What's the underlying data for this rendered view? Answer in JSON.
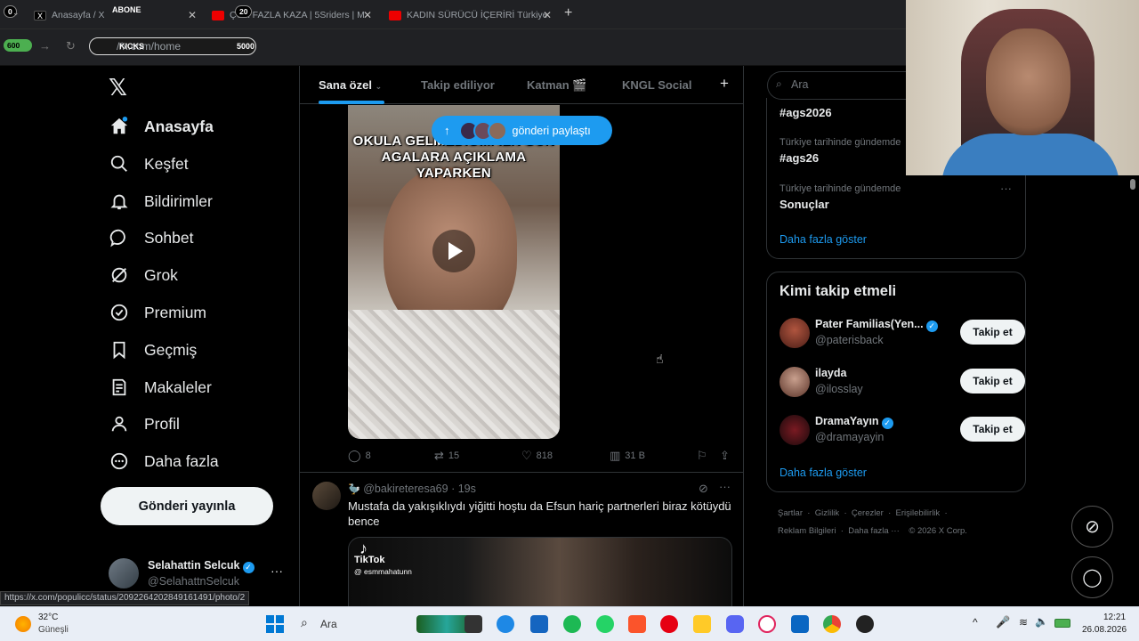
{
  "browser": {
    "tabs": [
      {
        "title": "Anasayfa / X"
      },
      {
        "title": "ÇOK FAZLA KAZA | 5Sriders | M"
      },
      {
        "title": "KADIN SÜRÜCÜ İÇERİRİ Türkiye"
      }
    ],
    "overlay_pills": {
      "p1": "0",
      "p2": "ABONE",
      "p3": "20",
      "p4": "600",
      "p5": "KICKS",
      "p6": "5000"
    },
    "url": "//x.com/home",
    "status_url": "https://x.com/populicc/status/2092264202849161491/photo/2"
  },
  "nav": {
    "items": [
      {
        "label": "Anasayfa",
        "icon": "home-icon"
      },
      {
        "label": "Keşfet",
        "icon": "search-icon"
      },
      {
        "label": "Bildirimler",
        "icon": "bell-icon"
      },
      {
        "label": "Sohbet",
        "icon": "chat-icon"
      },
      {
        "label": "Grok",
        "icon": "grok-icon"
      },
      {
        "label": "Premium",
        "icon": "premium-icon"
      },
      {
        "label": "Geçmiş",
        "icon": "bookmark-icon"
      },
      {
        "label": "Makaleler",
        "icon": "article-icon"
      },
      {
        "label": "Profil",
        "icon": "person-icon"
      },
      {
        "label": "Daha fazla",
        "icon": "more-circle-icon"
      }
    ],
    "post_button": "Gönderi yayınla",
    "account": {
      "name": "Selahattin Selcuk",
      "handle": "@SelahattnSelcuk"
    }
  },
  "feed": {
    "tabs": [
      "Sana özel",
      "Takip ediliyor",
      "Katman 🎬",
      "KNGL Social"
    ],
    "toast": "gönderi paylaştı",
    "tweet1": {
      "video_caption": "OKULA GELMEDİĞİM İLK GÜN AGALARA AÇIKLAMA YAPARKEN",
      "replies": "8",
      "retweets": "15",
      "likes": "818",
      "views": "31 B"
    },
    "tweet2": {
      "handle": "@bakireteresa69",
      "time": "· 19s",
      "text": "Mustafa da yakışıklıydı yiğitti hoştu da Efsun hariç partnerleri biraz kötüydü bence",
      "tiktok_label": "TikTok",
      "tiktok_user": "@ esmmahatunn"
    }
  },
  "sidebar": {
    "search_placeholder": "Ara",
    "trends": [
      {
        "context": "",
        "topic": "#ags2026"
      },
      {
        "context": "Türkiye tarihinde gündemde",
        "topic": "#ags26"
      },
      {
        "context": "Türkiye tarihinde gündemde",
        "topic": "Sonuçlar"
      }
    ],
    "trends_more": "Daha fazla göster",
    "who_to_follow": {
      "title": "Kimi takip etmeli",
      "items": [
        {
          "name": "Pater Familias(Yen...",
          "handle": "@paterisback",
          "verified": true,
          "button": "Takip et"
        },
        {
          "name": "ilayda",
          "handle": "@ilosslay",
          "verified": false,
          "button": "Takip et"
        },
        {
          "name": "DramaYayın",
          "handle": "@dramayayin",
          "verified": true,
          "button": "Takip et"
        }
      ],
      "more": "Daha fazla göster"
    },
    "footer": {
      "line1": [
        "Şartlar",
        "Gizlilik",
        "Çerezler",
        "Erişilebilirlik"
      ],
      "line2": [
        "Reklam Bilgileri",
        "Daha fazla ···",
        "© 2026 X Corp."
      ]
    }
  },
  "taskbar": {
    "weather_temp": "32°C",
    "weather_desc": "Güneşli",
    "search": "Ara",
    "time": "12:21",
    "date": "26.08.2026"
  }
}
